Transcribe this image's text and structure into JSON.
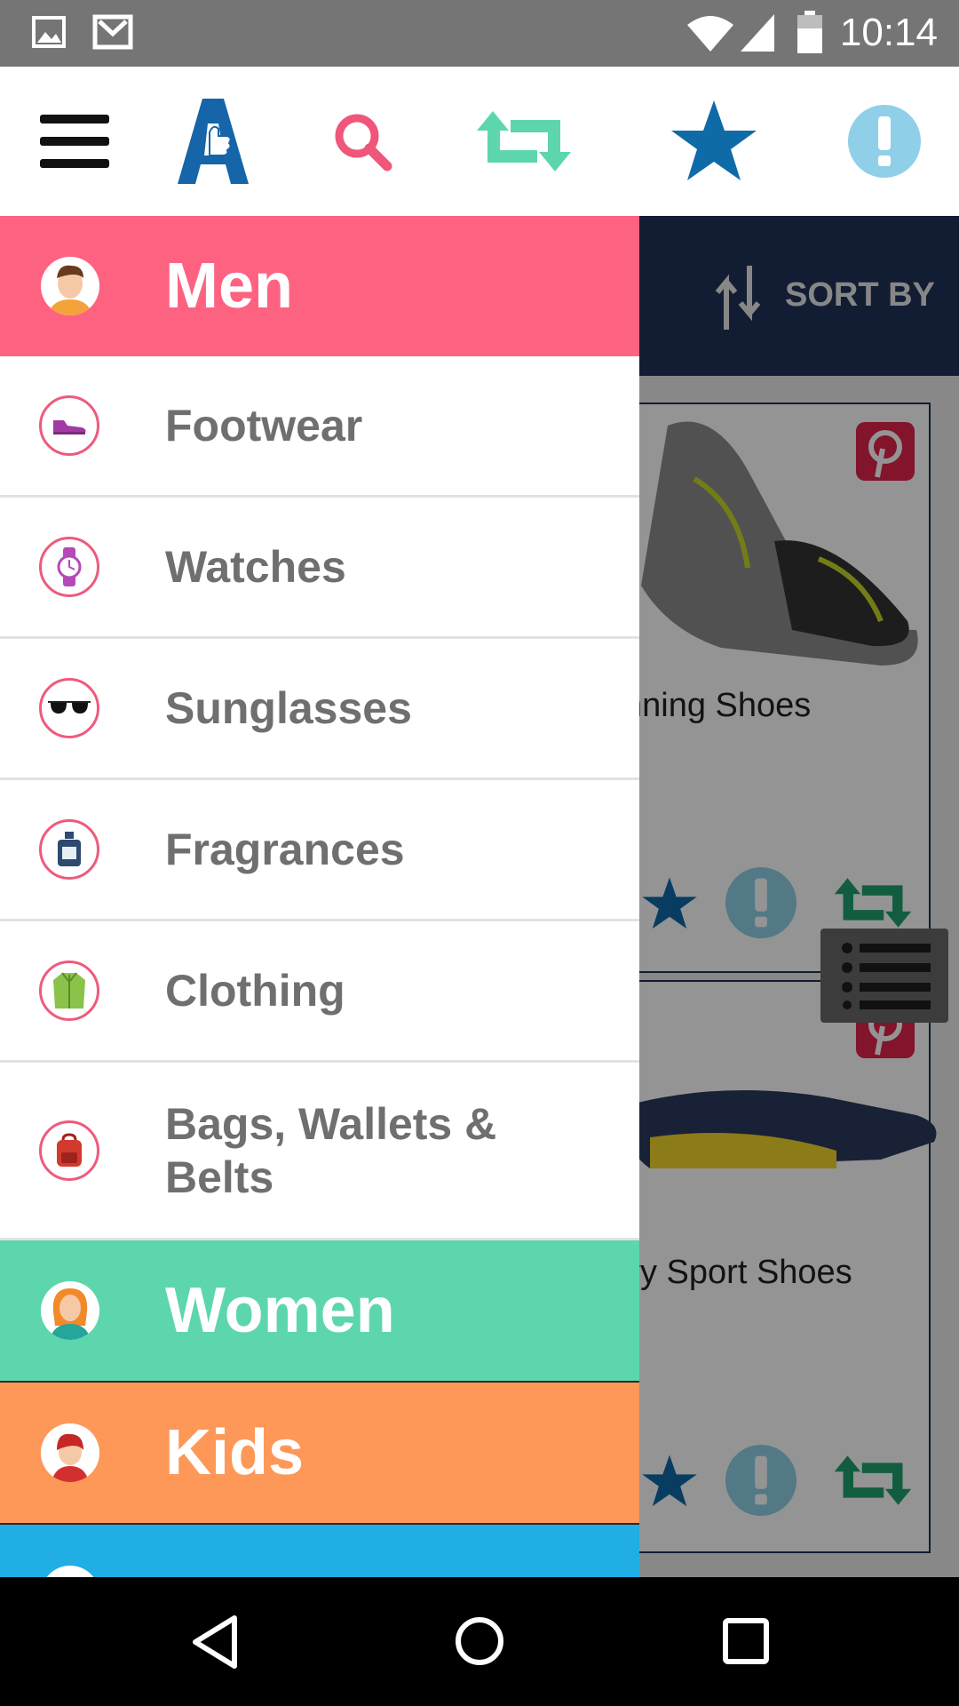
{
  "status_bar": {
    "time": "10:14",
    "icons": [
      "image-icon",
      "gmail-icon",
      "wifi-icon",
      "signal-icon",
      "battery-icon"
    ]
  },
  "toolbar": {
    "icons": [
      "menu-icon",
      "app-logo",
      "search-icon",
      "compare-icon",
      "favorites-star-icon",
      "alert-icon"
    ],
    "colors": {
      "search": "#f0567a",
      "compare": "#5dd6ae",
      "star": "#0f6aa8",
      "alert": "#8fd0e8",
      "logo": "#1565a8"
    }
  },
  "background": {
    "sort_label": "SORT BY",
    "products": [
      {
        "title": "nning Shoes"
      },
      {
        "title": "vy Sport Shoes"
      }
    ]
  },
  "drawer": {
    "categories": {
      "men": {
        "label": "Men",
        "color": "#fe6281"
      },
      "women": {
        "label": "Women",
        "color": "#5dd6ae"
      },
      "kids": {
        "label": "Kids",
        "color": "#fe9858"
      },
      "next": {
        "label": "",
        "color": "#20aee4"
      }
    },
    "men_items": [
      {
        "label": "Footwear",
        "icon": "shoe-icon"
      },
      {
        "label": "Watches",
        "icon": "watch-icon"
      },
      {
        "label": "Sunglasses",
        "icon": "sunglasses-icon"
      },
      {
        "label": "Fragrances",
        "icon": "perfume-icon"
      },
      {
        "label": "Clothing",
        "icon": "jacket-icon"
      },
      {
        "label": "Bags, Wallets & Belts",
        "icon": "backpack-icon"
      }
    ]
  }
}
